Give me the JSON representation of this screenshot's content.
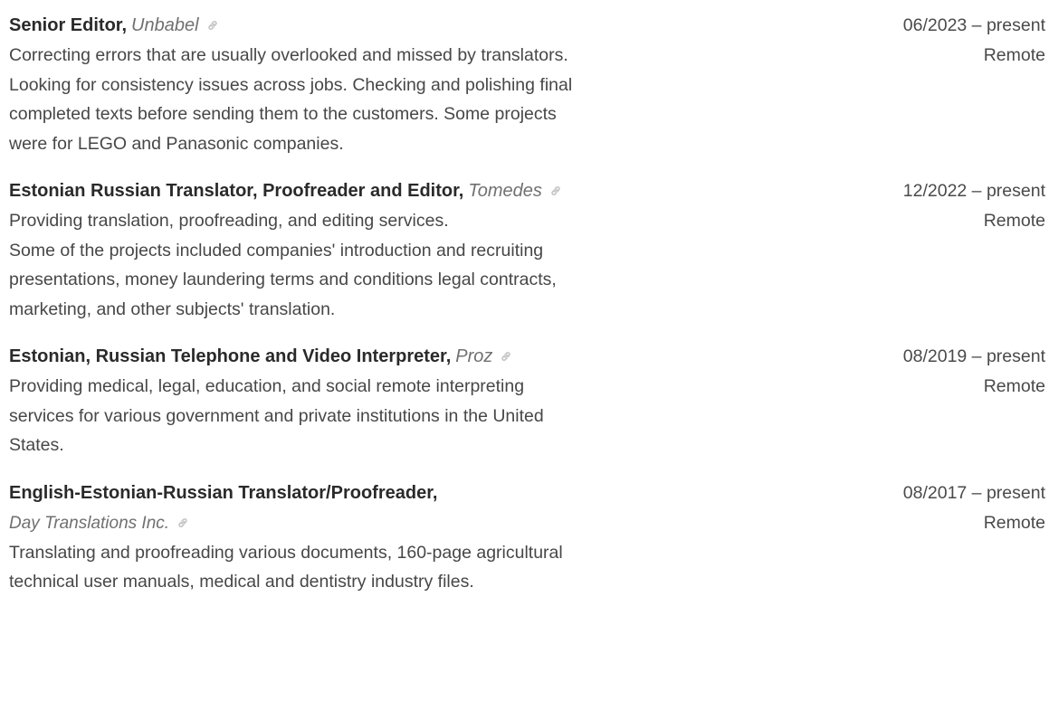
{
  "entries": [
    {
      "role": "Senior Editor,",
      "company": "Unbabel",
      "company_on_new_line": false,
      "date": "06/2023 – present",
      "location": "Remote",
      "description": [
        "Correcting errors that are usually overlooked and missed by translators.",
        "Looking for consistency issues across jobs. Checking and polishing final",
        "completed texts before sending them to the customers. Some projects",
        "were for LEGO and Panasonic companies."
      ]
    },
    {
      "role": "Estonian Russian Translator, Proofreader and Editor,",
      "company": "Tomedes",
      "company_on_new_line": false,
      "date": "12/2022 – present",
      "location": "Remote",
      "description": [
        "Providing translation, proofreading, and editing services.",
        "Some of the projects included companies' introduction and recruiting",
        "presentations, money laundering terms and conditions legal contracts,",
        "marketing, and other subjects' translation."
      ]
    },
    {
      "role": "Estonian, Russian Telephone and Video Interpreter,",
      "company": "Proz",
      "company_on_new_line": false,
      "date": "08/2019 – present",
      "location": "Remote",
      "description": [
        "Providing medical, legal, education, and social remote interpreting",
        "services for various government and private institutions in the United",
        "States."
      ]
    },
    {
      "role": "English-Estonian-Russian Translator/Proofreader,",
      "company": "Day Translations Inc.",
      "company_on_new_line": true,
      "date": "08/2017 – present",
      "location": "Remote",
      "description": [
        "Translating and proofreading various documents, 160-page agricultural",
        "technical user manuals, medical and dentistry industry files."
      ]
    }
  ],
  "icons": {
    "link": "link-icon"
  },
  "colors": {
    "title": "#2a2a2a",
    "company": "#707070",
    "body": "#474747",
    "icon": "#c4c4c4"
  }
}
